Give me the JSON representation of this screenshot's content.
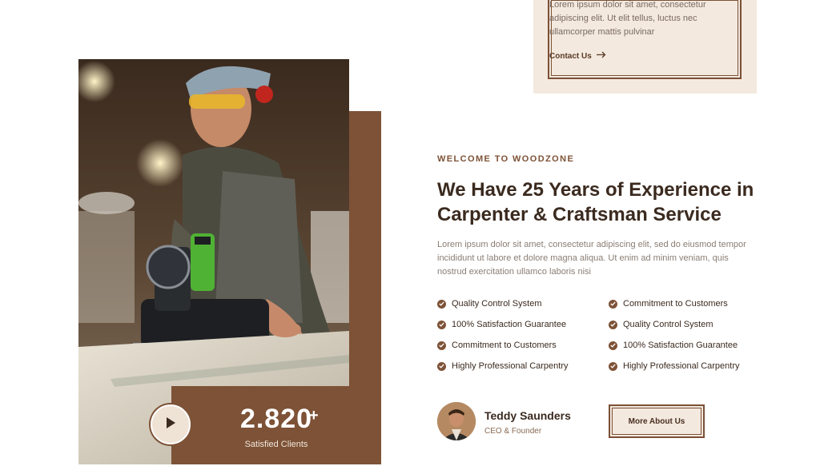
{
  "contact_card": {
    "text": "Lorem ipsum dolor sit amet, consectetur adipiscing elit. Ut elit tellus, luctus nec ullamcorper mattis pulvinar",
    "link_label": "Contact Us"
  },
  "stats": {
    "number": "2.820",
    "plus": "+",
    "label": "Satisfied Clients"
  },
  "intro": {
    "eyebrow": "WELCOME TO WOODZONE",
    "headline": "We Have 25 Years of Experience in Carpenter & Craftsman Service",
    "lead": "Lorem ipsum dolor sit amet, consectetur adipiscing elit, sed do eiusmod tempor incididunt ut labore et dolore magna aliqua. Ut enim ad minim veniam, quis nostrud exercitation ullamco laboris nisi"
  },
  "features": [
    "Quality Control System",
    "Commitment to Customers",
    "100% Satisfaction Guarantee",
    "Quality Control System",
    "Commitment to Customers",
    "100% Satisfaction Guarantee",
    "Highly Professional Carpentry",
    "Highly Professional Carpentry"
  ],
  "person": {
    "name": "Teddy Saunders",
    "role": "CEO & Founder"
  },
  "cta": {
    "label": "More About Us"
  },
  "colors": {
    "brand_brown": "#7d5236",
    "dark_text": "#3b2a1f",
    "cream": "#f3e9df"
  },
  "icons": {
    "check": "check-circle-icon",
    "arrow": "arrow-right-icon",
    "play": "play-icon"
  }
}
